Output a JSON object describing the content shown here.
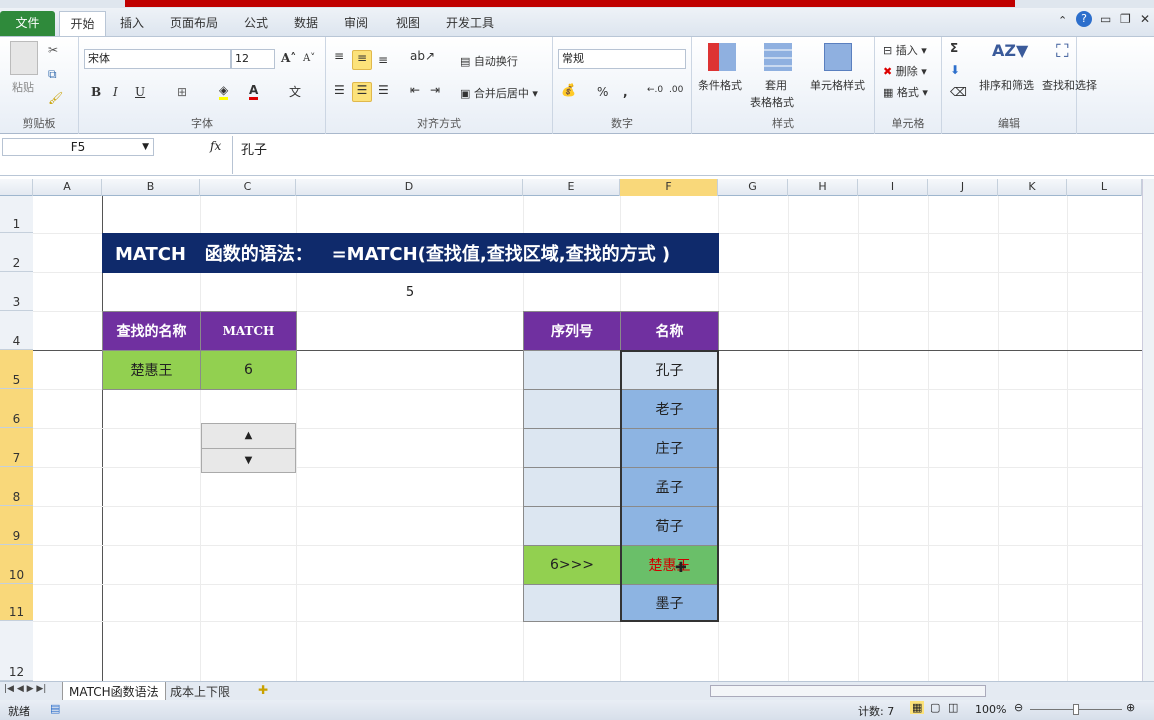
{
  "window": {
    "accent": "#c00000"
  },
  "tabs": [
    "文件",
    "开始",
    "插入",
    "页面布局",
    "公式",
    "数据",
    "审阅",
    "视图",
    "开发工具"
  ],
  "ribbon": {
    "clipboard": {
      "paste": "粘贴",
      "label": "剪贴板"
    },
    "font": {
      "name": "宋体",
      "size": "12",
      "label": "字体"
    },
    "alignment": {
      "wrap": "自动换行",
      "merge": "合并后居中",
      "label": "对齐方式"
    },
    "number": {
      "format": "常规",
      "percent": "%",
      "comma": ",",
      "label": "数字"
    },
    "styles": {
      "conditional": "条件格式",
      "table1": "套用",
      "table2": "表格格式",
      "cell": "单元格样式",
      "label": "样式"
    },
    "cells": {
      "insert": "插入",
      "delete": "删除",
      "format": "格式",
      "label": "单元格"
    },
    "editing": {
      "sort": "排序和筛选",
      "find": "查找和选择",
      "sum": "Σ",
      "label": "编辑"
    }
  },
  "formula_bar": {
    "name_box": "F5",
    "fx": "fx",
    "value": "孔子"
  },
  "columns": [
    "A",
    "B",
    "C",
    "D",
    "E",
    "F",
    "G",
    "H",
    "I",
    "J",
    "K",
    "L"
  ],
  "rows": [
    "1",
    "2",
    "3",
    "4",
    "5",
    "6",
    "7",
    "8",
    "9",
    "10",
    "11",
    "12"
  ],
  "sheet": {
    "title": "MATCH   函数的语法：   =MATCH(查找值,查找区域,查找的方式 )",
    "d3": "5",
    "lookup_header": "查找的名称",
    "match_header": "MATCH",
    "lookup_value": "楚惠王",
    "match_value": "6",
    "list_header_seq": "序列号",
    "list_header_name": "名称",
    "seq": [
      "",
      "",
      "",
      "",
      "",
      "6>>>",
      ""
    ],
    "names": [
      "孔子",
      "老子",
      "庄子",
      "孟子",
      "荀子",
      "楚惠王",
      "墨子"
    ],
    "colors": {
      "title_bg": "#0f2a6b",
      "header_bg": "#7030a0",
      "green": "#92d050",
      "list_blue": "#8db4e2",
      "seq_bg": "#dce6f1",
      "match_bg": "#6abf69",
      "match_text": "#d00000"
    }
  },
  "sheet_tabs": [
    "MATCH函数语法",
    "成本上下限"
  ],
  "status": {
    "ready": "就绪",
    "count": "计数: 7",
    "zoom": "100%"
  }
}
